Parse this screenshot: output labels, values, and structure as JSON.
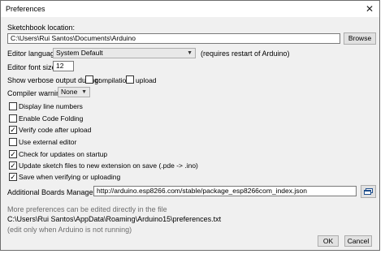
{
  "window": {
    "title": "Preferences",
    "close_glyph": "✕"
  },
  "sketchbook": {
    "label": "Sketchbook location:",
    "path": "C:\\Users\\Rui Santos\\Documents\\Arduino",
    "browse_label": "Browse"
  },
  "language": {
    "label": "Editor language:",
    "value": "System Default",
    "note": "(requires restart of Arduino)"
  },
  "font_size": {
    "label": "Editor font size:",
    "value": "12"
  },
  "verbose": {
    "label": "Show verbose output during:",
    "compilation_label": "compilation",
    "compilation_checked": false,
    "upload_label": "upload",
    "upload_checked": false
  },
  "warnings": {
    "label": "Compiler warnings:",
    "value": "None"
  },
  "options": [
    {
      "label": "Display line numbers",
      "checked": false
    },
    {
      "label": "Enable Code Folding",
      "checked": false
    },
    {
      "label": "Verify code after upload",
      "checked": true
    },
    {
      "label": "Use external editor",
      "checked": false
    },
    {
      "label": "Check for updates on startup",
      "checked": true
    },
    {
      "label": "Update sketch files to new extension on save (.pde -> .ino)",
      "checked": true
    },
    {
      "label": "Save when verifying or uploading",
      "checked": true
    }
  ],
  "boards": {
    "label": "Additional Boards Manager URLs:",
    "value": "http://arduino.esp8266.com/stable/package_esp8266com_index.json",
    "button_icon": "window-icon"
  },
  "footer": {
    "more_prefs": "More preferences can be edited directly in the file",
    "prefs_path": "C:\\Users\\Rui Santos\\AppData\\Roaming\\Arduino15\\preferences.txt",
    "edit_note": "(edit only when Arduino is not running)",
    "ok_label": "OK",
    "cancel_label": "Cancel"
  },
  "check_glyph": "✓"
}
